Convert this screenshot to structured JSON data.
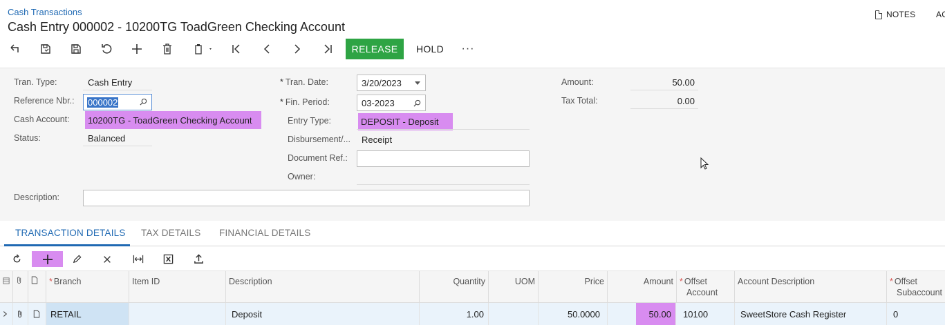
{
  "header": {
    "breadcrumb": "Cash Transactions",
    "title": "Cash Entry 000002 - 10200TG ToadGreen Checking Account",
    "notes_label": "NOTES",
    "activities_label": "AC"
  },
  "toolbar": {
    "release_label": "RELEASE",
    "hold_label": "HOLD",
    "more_label": "···"
  },
  "form": {
    "tran_type_label": "Tran. Type:",
    "tran_type_value": "Cash Entry",
    "reference_nbr_label": "Reference Nbr.:",
    "reference_nbr_value": "000002",
    "cash_account_label": "Cash Account:",
    "cash_account_value": "10200TG - ToadGreen Checking Account",
    "status_label": "Status:",
    "status_value": "Balanced",
    "tran_date_label": "Tran. Date:",
    "tran_date_value": "3/20/2023",
    "fin_period_label": "Fin. Period:",
    "fin_period_value": "03-2023",
    "entry_type_label": "Entry Type:",
    "entry_type_value": "DEPOSIT - Deposit",
    "disbursement_label": "Disbursement/...",
    "disbursement_value": "Receipt",
    "document_ref_label": "Document Ref.:",
    "document_ref_value": "",
    "owner_label": "Owner:",
    "owner_value": "",
    "amount_label": "Amount:",
    "amount_value": "50.00",
    "tax_total_label": "Tax Total:",
    "tax_total_value": "0.00",
    "description_label": "Description:",
    "description_value": "",
    "required_marker": "*"
  },
  "tabs": [
    {
      "label": "TRANSACTION DETAILS",
      "active": true
    },
    {
      "label": "TAX DETAILS",
      "active": false
    },
    {
      "label": "FINANCIAL DETAILS",
      "active": false
    }
  ],
  "grid": {
    "columns": {
      "branch": "Branch",
      "item_id": "Item ID",
      "description": "Description",
      "quantity": "Quantity",
      "uom": "UOM",
      "price": "Price",
      "amount": "Amount",
      "offset_account_1": "Offset",
      "offset_account_2": "Account",
      "account_description": "Account Description",
      "offset_subaccount_1": "Offset",
      "offset_subaccount_2": "Subaccount"
    },
    "rows": [
      {
        "branch": "RETAIL",
        "item_id": "",
        "description": "Deposit",
        "quantity": "1.00",
        "uom": "",
        "price": "50.0000",
        "amount": "50.00",
        "offset_account": "10100",
        "account_description": "SweetStore Cash Register",
        "offset_subaccount": "0"
      }
    ]
  },
  "colors": {
    "accent": "#1f69b3",
    "release": "#2ea444",
    "highlight": "#d88cf0"
  }
}
